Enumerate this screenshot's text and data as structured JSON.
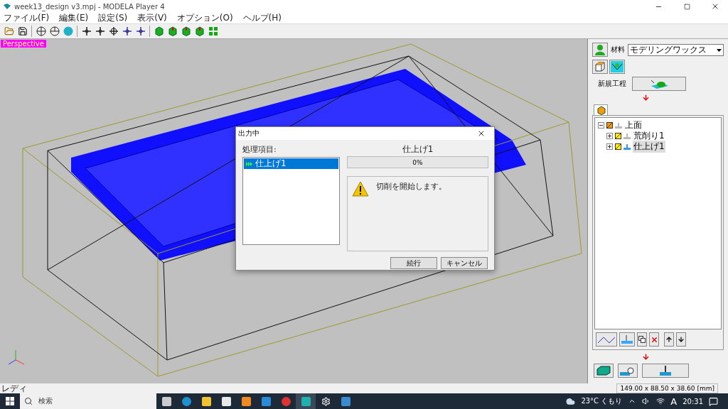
{
  "window": {
    "title": "week13_design v3.mpj - MODELA Player 4"
  },
  "menu": [
    "ファイル(F)",
    "編集(E)",
    "設定(S)",
    "表示(V)",
    "オプション(O)",
    "ヘルプ(H)"
  ],
  "viewport": {
    "label": "Perspective"
  },
  "dialog": {
    "title": "出力中",
    "list_label": "処理項目:",
    "items": [
      {
        "label": "仕上げ1",
        "selected": true
      }
    ],
    "current": "仕上げ1",
    "progress": {
      "level": 0,
      "reading": "0%"
    },
    "message": "切削を開始します。",
    "buttons": [
      "続行",
      "キャンセル"
    ]
  },
  "panel": {
    "material_label": "材料",
    "material": "モデリングワックス",
    "new_process_label": "新規工程",
    "tree": [
      {
        "label": "上面",
        "expanded": true,
        "selected": false,
        "children": [
          {
            "label": "荒削り1",
            "expanded": false,
            "selected": false
          },
          {
            "label": "仕上げ1",
            "expanded": false,
            "selected": true
          }
        ]
      }
    ]
  },
  "status_bar": {
    "text": "レディ",
    "dimensions": "149.00 x 88.50 x 38.60 [mm]"
  },
  "taskbar": {
    "search_placeholder": "検索",
    "weather": "23°C くもり",
    "ime": "A",
    "time": "20:31"
  }
}
